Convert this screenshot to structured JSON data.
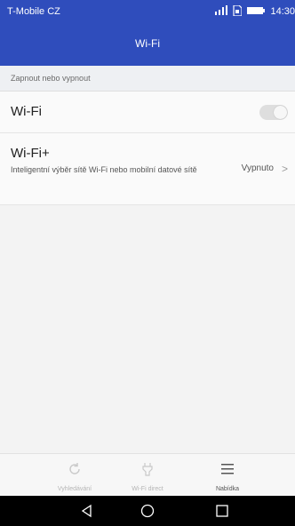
{
  "status_bar": {
    "carrier": "T-Mobile CZ",
    "time": "14:30"
  },
  "header": {
    "title": "Wi-Fi"
  },
  "section": {
    "label": "Zapnout nebo vypnout"
  },
  "wifi_row": {
    "title": "Wi-Fi",
    "toggle_on": false
  },
  "wifiplus_row": {
    "title": "Wi-Fi+",
    "description": "Inteligentní výběr sítě Wi-Fi nebo mobilní datové sítě",
    "value": "Vypnuto"
  },
  "bottom_bar": {
    "items": [
      {
        "label": "Vyhledávání",
        "icon": "refresh-icon"
      },
      {
        "label": "Wi-Fi direct",
        "icon": "wifi-direct-icon"
      },
      {
        "label": "Nabídka",
        "icon": "menu-icon"
      }
    ]
  },
  "colors": {
    "accent": "#2f4dbc"
  }
}
